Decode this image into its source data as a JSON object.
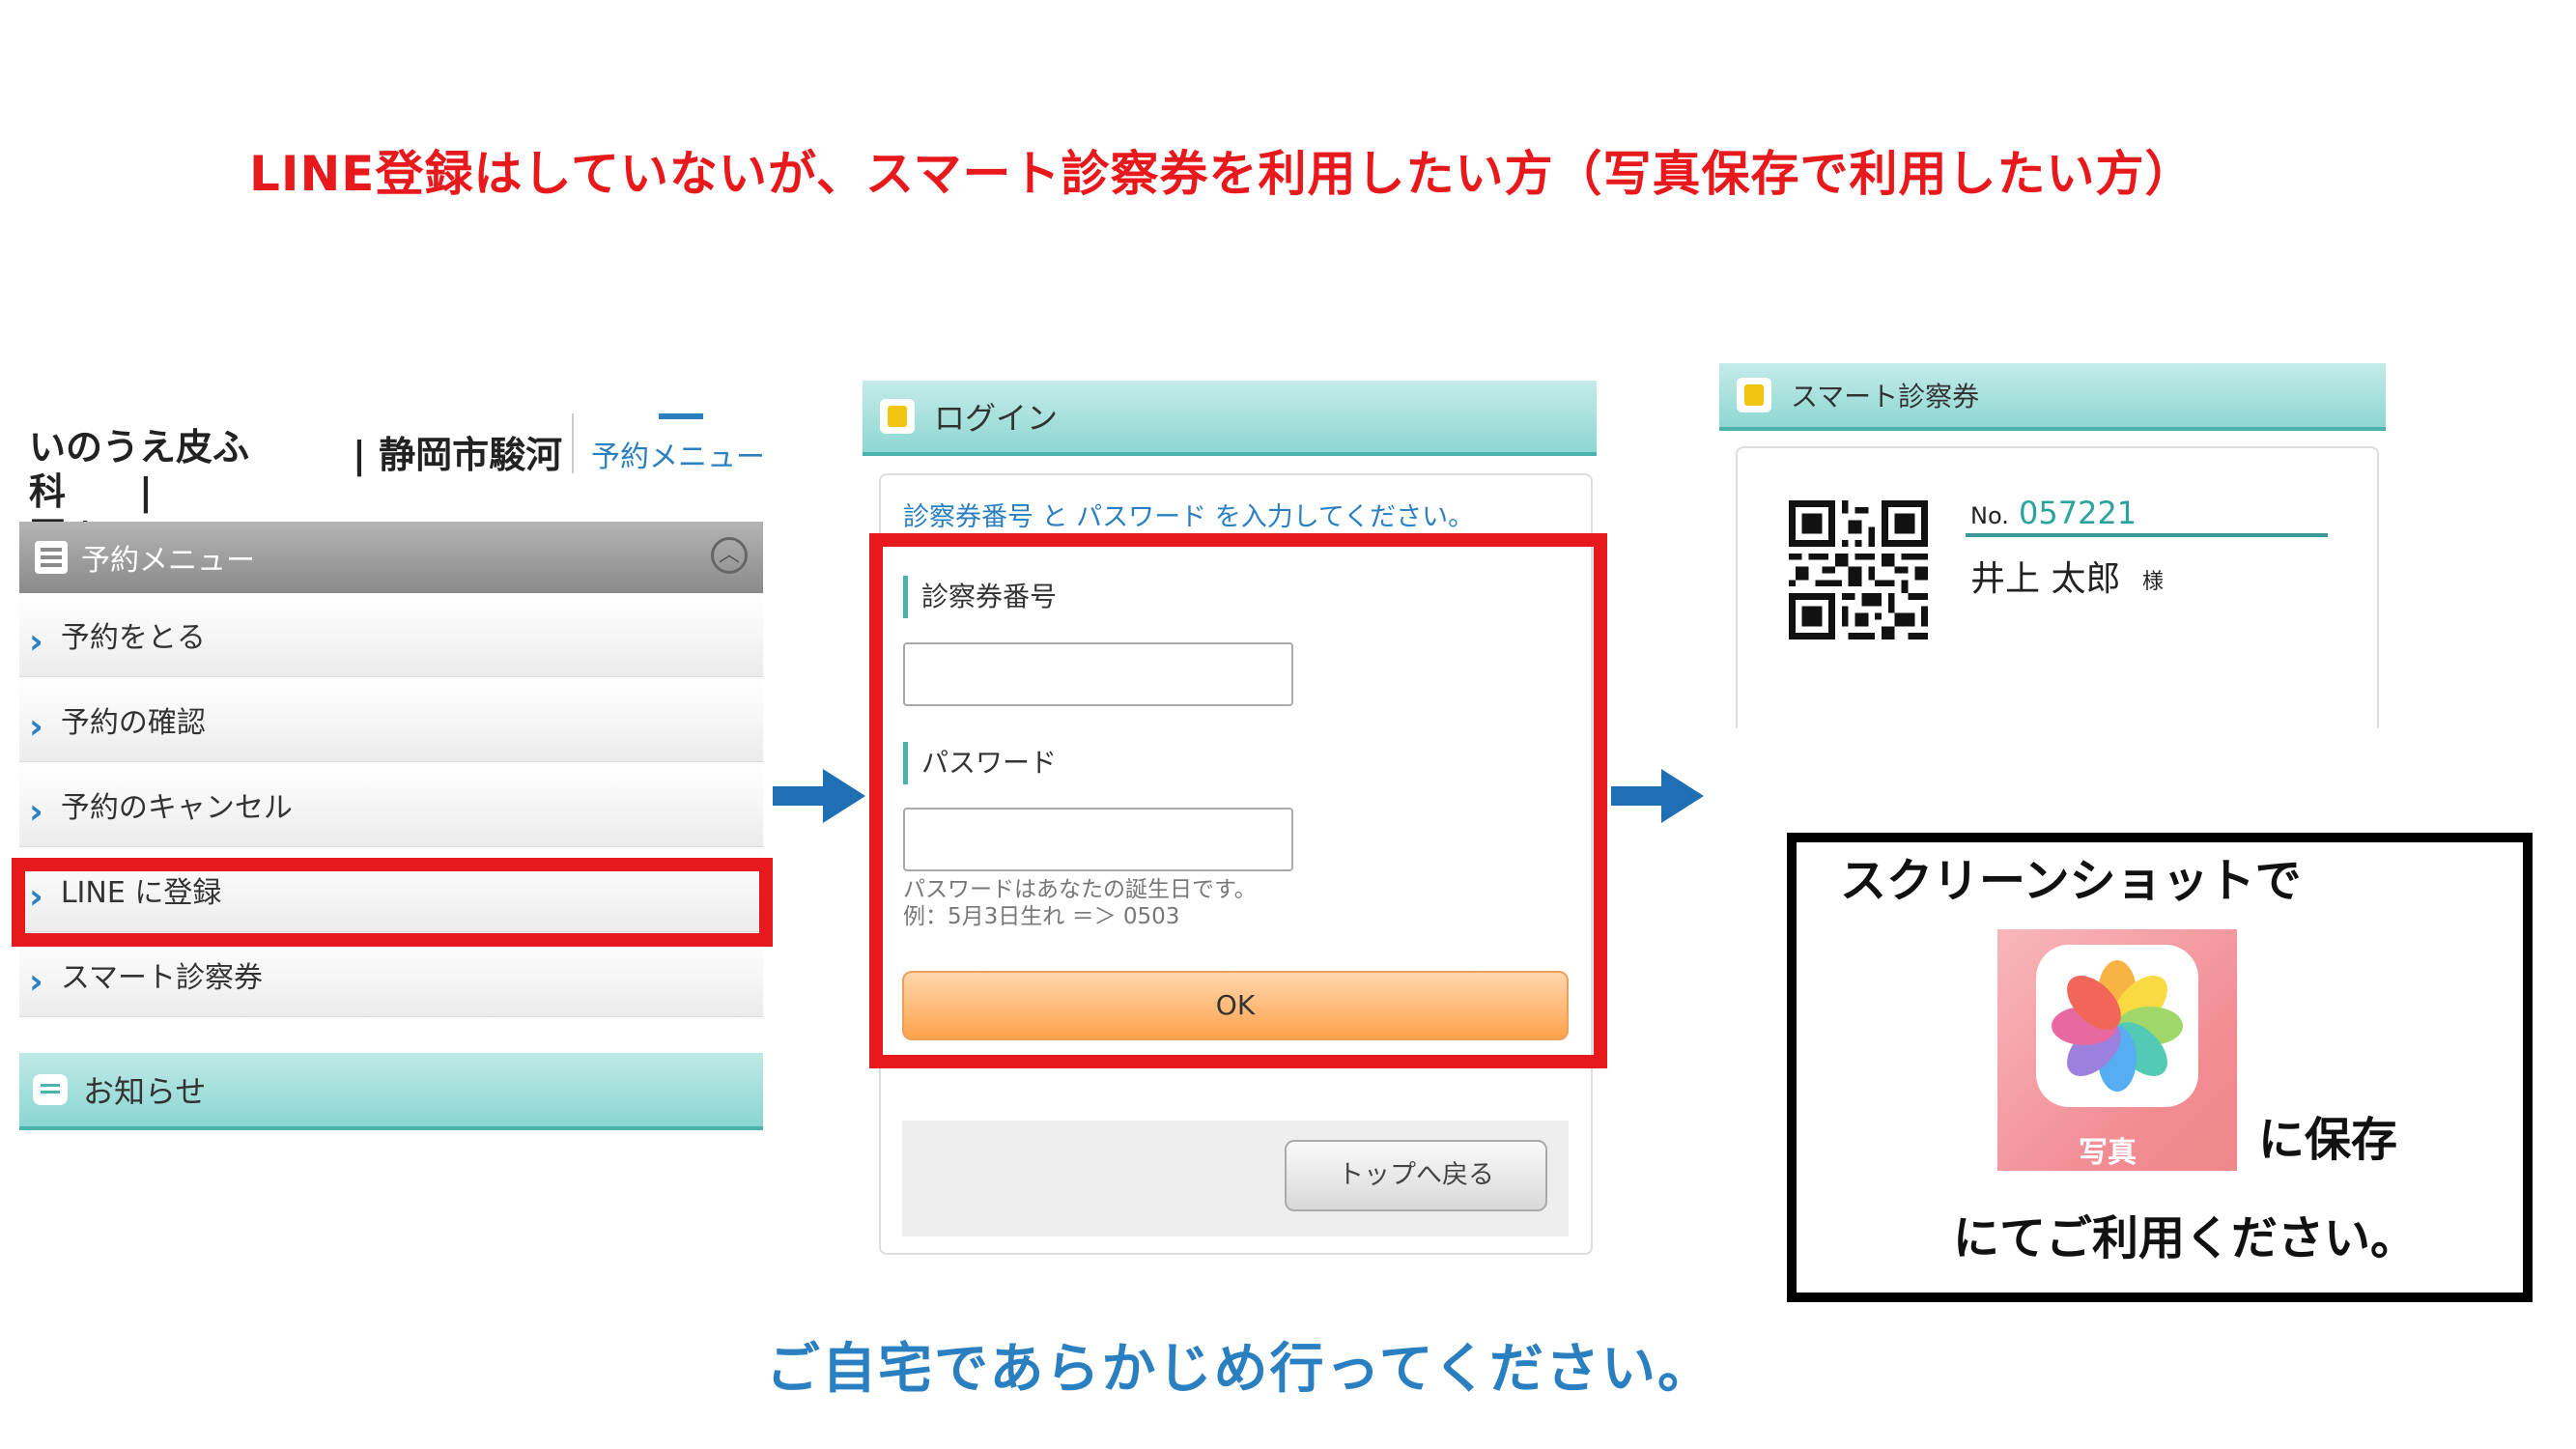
{
  "heading": "LINE登録はしていないが、スマート診察券を利用したい方（写真保存で利用したい方）",
  "panel_menu": {
    "clinic_name": "いのうえ皮ふ科　　|",
    "clinic_name_2": "区 |",
    "clinic_city": "| 静岡市駿河",
    "top_menu_link": "予約メニュー",
    "header": "予約メニュー",
    "items": [
      {
        "label": "予約をとる"
      },
      {
        "label": "予約の確認"
      },
      {
        "label": "予約のキャンセル"
      },
      {
        "label": "LINE に登録"
      },
      {
        "label": "スマート診察券"
      }
    ],
    "news_header": "お知らせ"
  },
  "panel_login": {
    "title": "ログイン",
    "instruction": "診察券番号 と パスワード を入力してください。",
    "card_number_label": "診察券番号",
    "card_number_value": "",
    "password_label": "パスワード",
    "password_value": "",
    "password_note_1": "パスワードはあなたの誕生日です。",
    "password_note_2": "例：5月3日生れ ＝＞ 0503",
    "ok_label": "OK",
    "back_label": "トップへ戻る"
  },
  "panel_card": {
    "title": "スマート診察券",
    "no_label": "No.",
    "no_value": "057221",
    "name": "井上 太郎",
    "honorific": "様"
  },
  "save_box": {
    "line1": "スクリーンショットで",
    "app_name": "写真",
    "line2": "に保存",
    "line3": "にてご利用ください。"
  },
  "bottom_note": "ご自宅であらかじめ行ってください。",
  "colors": {
    "accent_red": "#e8191c",
    "accent_blue": "#2a7fc0",
    "teal": "#4bb3ad"
  }
}
